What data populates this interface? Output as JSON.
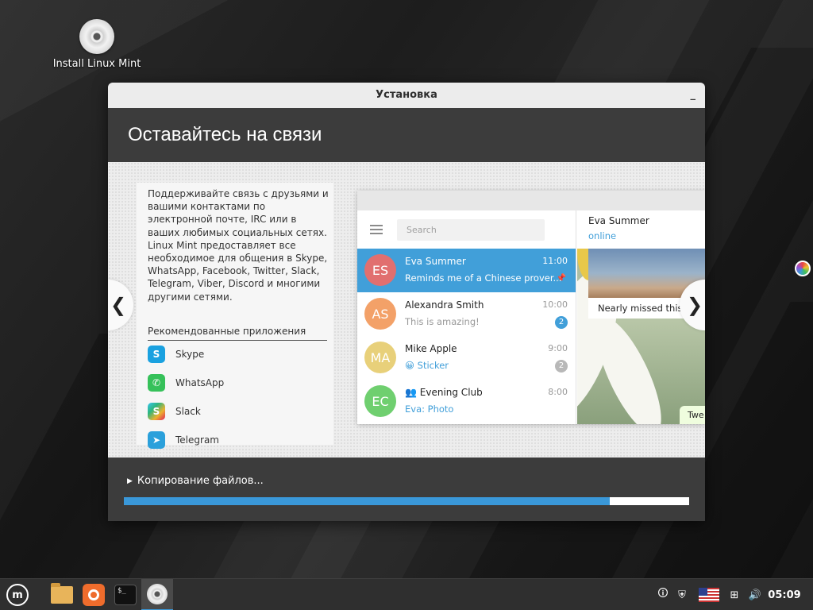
{
  "desktop": {
    "icon_label": "Install Linux Mint"
  },
  "window": {
    "title": "Установка",
    "minimize_glyph": "_",
    "heading": "Оставайтесь на связи"
  },
  "slide": {
    "description": "Поддерживайте связь с друзьями и вашими контактами по электронной почте, IRC или в ваших любимых социальных сетях. Linux Mint предоставляет все необходимое для общения в Skype, WhatsApp, Facebook, Twitter, Slack, Telegram, Viber, Discord и многими другими сетями.",
    "recommended_title": "Рекомендованные приложения",
    "apps": [
      {
        "name": "Skype",
        "icon": "skype-icon",
        "color": "#1aa1e0",
        "glyph": "S"
      },
      {
        "name": "WhatsApp",
        "icon": "whatsapp-icon",
        "color": "#36c15a",
        "glyph": "✆"
      },
      {
        "name": "Slack",
        "icon": "slack-icon",
        "color": "#d83a5b",
        "glyph": "S"
      },
      {
        "name": "Telegram",
        "icon": "telegram-icon",
        "color": "#2ba0db",
        "glyph": "➤"
      }
    ],
    "prev_glyph": "❮",
    "next_glyph": "❯"
  },
  "telegram_mock": {
    "search_placeholder": "Search",
    "chats": [
      {
        "initials": "ES",
        "name": "Eva Summer",
        "time": "11:00",
        "message": "Reminds me of a Chinese prover...",
        "avatar_color": "#e16f6f",
        "active": true,
        "badge": "",
        "pin": "📌"
      },
      {
        "initials": "AS",
        "name": "Alexandra Smith",
        "time": "10:00",
        "message": "This is amazing!",
        "avatar_color": "#f3a168",
        "active": false,
        "badge": "2",
        "badge_color": "#419fd9"
      },
      {
        "initials": "MA",
        "name": "Mike Apple",
        "time": "9:00",
        "message": "😀 Sticker",
        "avatar_color": "#e8d07a",
        "active": false,
        "badge": "2",
        "badge_color": "#b8b8b8",
        "message_color": "#419fd9"
      },
      {
        "initials": "EC",
        "name": "Evening Club",
        "time": "8:00",
        "message": "Eva: Photo",
        "avatar_color": "#6fcf6f",
        "active": false,
        "badge": "",
        "message_color": "#419fd9",
        "group": true
      }
    ],
    "contact_name": "Eva Summer",
    "contact_status": "online",
    "photo_caption": "Nearly missed this s",
    "bubble_text": "Twe"
  },
  "progress": {
    "label": "Копирование файлов...",
    "fraction": 0.86
  },
  "taskbar": {
    "clock": "05:09",
    "terminal_glyph": "$_"
  }
}
